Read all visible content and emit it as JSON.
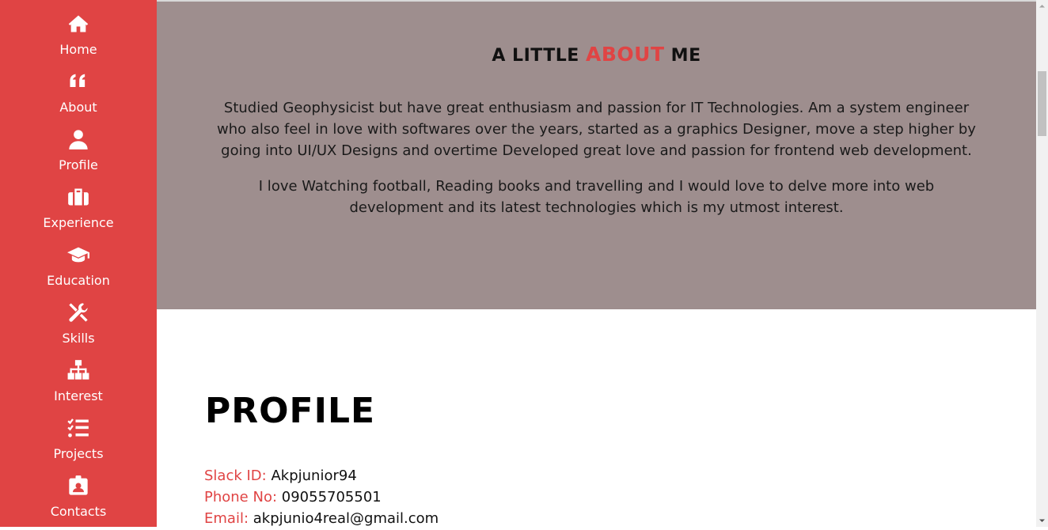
{
  "sidebar": {
    "items": [
      {
        "label": "Home",
        "icon": "home-icon"
      },
      {
        "label": "About",
        "icon": "quote-icon"
      },
      {
        "label": "Profile",
        "icon": "user-icon"
      },
      {
        "label": "Experience",
        "icon": "briefcase-icon"
      },
      {
        "label": "Education",
        "icon": "graduation-cap-icon"
      },
      {
        "label": "Skills",
        "icon": "tools-icon"
      },
      {
        "label": "Interest",
        "icon": "sitemap-icon"
      },
      {
        "label": "Projects",
        "icon": "tasks-icon"
      },
      {
        "label": "Contacts",
        "icon": "id-badge-icon"
      }
    ]
  },
  "about": {
    "title_prefix": "A LITTLE ",
    "title_accent": "ABOUT",
    "title_suffix": " ME",
    "paragraph1": "Studied Geophysicist but have great enthusiasm and passion for IT Technologies. Am a system engineer who also feel in love with softwares over the years, started as a graphics Designer, move a step higher by going into UI/UX Designs and overtime Developed great love and passion for frontend web development.",
    "paragraph2": "I love Watching football, Reading books and travelling and I would love to delve more into web development and its latest technologies which is my utmost interest."
  },
  "profile": {
    "title": "PROFILE",
    "slack_label": "Slack ID:",
    "slack_value": "Akpjunior94",
    "phone_label": "Phone No:",
    "phone_value": "09055705501",
    "email_label": "Email:",
    "email_value": "akpjunio4real@gmail.com"
  },
  "colors": {
    "accent": "#e04444",
    "about_bg": "#9e8e8e"
  }
}
